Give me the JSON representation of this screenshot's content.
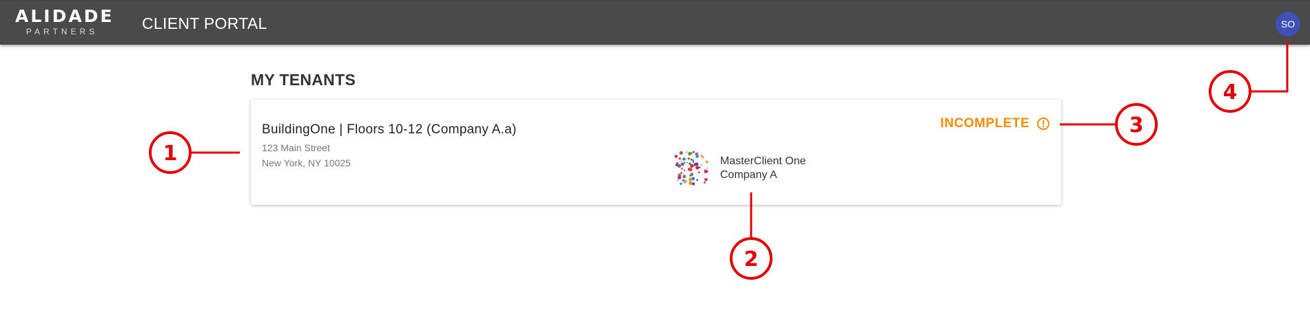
{
  "header": {
    "logo_main": "ALIDADE",
    "logo_sub": "PARTNERS",
    "title": "CLIENT PORTAL",
    "avatar_initials": "SO",
    "avatar_color": "#3f51b5"
  },
  "main": {
    "heading": "MY TENANTS",
    "tenants": [
      {
        "name": "BuildingOne | Floors 10-12 (Company A.a)",
        "address_line1": "123 Main Street",
        "address_line2": "New York, NY 10025",
        "status": "INCOMPLETE",
        "status_color": "#f08c00",
        "status_icon": "alert-circle-icon",
        "client_name": "MasterClient One",
        "client_company": "Company A"
      }
    ]
  },
  "annotations": {
    "color": "#e00000",
    "markers": [
      "1",
      "2",
      "3",
      "4"
    ]
  }
}
